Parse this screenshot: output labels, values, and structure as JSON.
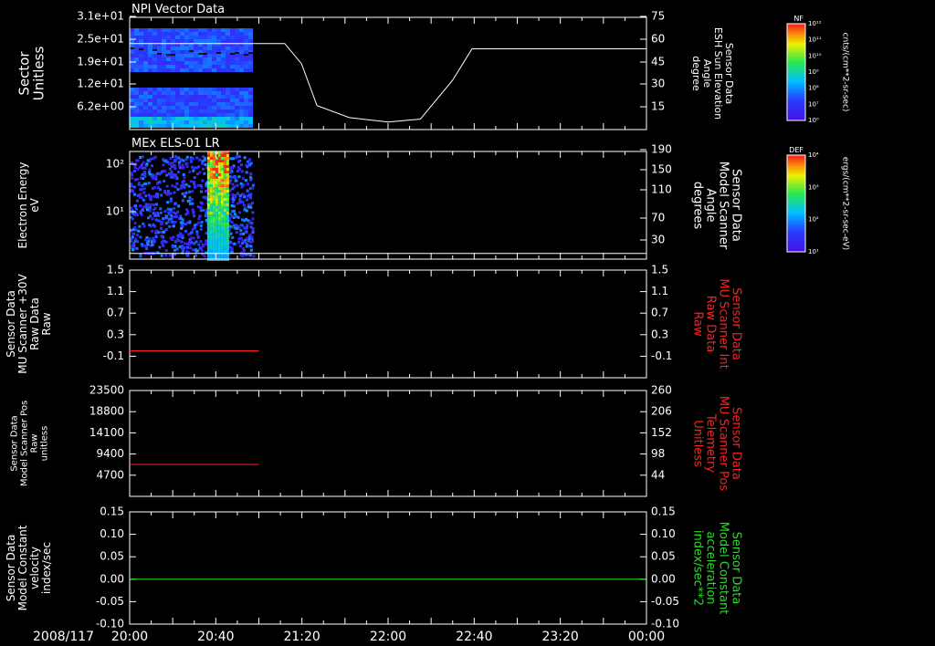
{
  "chart_data": [
    {
      "type": "heatmap",
      "title": "NPI Vector Data",
      "ylabel": [
        "Sector",
        "Unitless"
      ],
      "yticks": [
        "3.1e+01",
        "2.5e+01",
        "1.9e+01",
        "1.2e+01",
        "6.2e+00"
      ],
      "right_ylabel": [
        "Sensor Data",
        "ESH Sun Elevation",
        "Angle",
        "degree"
      ],
      "right_yticks": [
        "75",
        "60",
        "45",
        "30",
        "15"
      ],
      "right_ylim": [
        0,
        75
      ],
      "line_series": {
        "name": "ESH Sun Elevation",
        "color": "#ffffff",
        "x_hours": [
          20.0,
          21.2,
          21.33,
          21.45,
          21.7,
          22.0,
          22.25,
          22.5,
          22.65,
          24.0
        ],
        "y": [
          57.5,
          57.5,
          44,
          16,
          8,
          5,
          7,
          33,
          54,
          54
        ]
      },
      "data_extent_hours": [
        20.0,
        20.95
      ],
      "colorbar": {
        "label": "NF",
        "units": "cnts/(cm**2-sr-sec)",
        "ticks": [
          "10⁰",
          "10⁷",
          "10⁸",
          "10⁹",
          "10¹⁰",
          "10¹¹",
          "10¹²"
        ]
      }
    },
    {
      "type": "heatmap",
      "title": "MEx ELS-01 LR",
      "ylabel": [
        "Electron Energy",
        "eV"
      ],
      "yticks": [
        "10²",
        "10¹"
      ],
      "right_ylabel": [
        "Sensor Data",
        "Model Scanner",
        "Angle",
        "degrees"
      ],
      "right_yticks": [
        "190",
        "150",
        "110",
        "70",
        "30"
      ],
      "right_ylim": [
        0,
        190
      ],
      "line_series": {
        "name": "Model Scanner Angle",
        "color": "#ffffff",
        "x_hours": [
          20.0,
          24.0
        ],
        "y": [
          10,
          10
        ]
      },
      "data_extent_hours": [
        20.0,
        20.95
      ],
      "colorbar": {
        "label": "DEF",
        "units": "ergs/(cm**2-sr-sec-eV)",
        "ticks": [
          "10¹",
          "10²",
          "10³",
          "10⁴"
        ]
      }
    },
    {
      "type": "line",
      "ylabel": [
        "Sensor Data",
        "MU Scanner +30V",
        "Raw Data",
        "Raw"
      ],
      "yticks": [
        "1.5",
        "1.1",
        "0.7",
        "0.3",
        "-0.1"
      ],
      "ylim": [
        -0.5,
        1.5
      ],
      "right_ylabel": [
        "Sensor Data",
        "MU Scanner Int",
        "Raw Data",
        "Raw"
      ],
      "right_yticks": [
        "1.5",
        "1.1",
        "0.7",
        "0.3",
        "-0.1"
      ],
      "series": [
        {
          "color": "#ff2020",
          "x_hours": [
            20.0,
            21.0
          ],
          "y": [
            0.0,
            0.0
          ]
        }
      ]
    },
    {
      "type": "line",
      "ylabel": [
        "Sensor Data",
        "Model Scanner Pos",
        "Raw",
        "unitless"
      ],
      "yticks": [
        "23500",
        "18800",
        "14100",
        "9400",
        "4700"
      ],
      "ylim": [
        0,
        23500
      ],
      "right_ylabel": [
        "Sensor Data",
        "MU Scanner Pos",
        "Telemetry",
        "Unitless"
      ],
      "right_yticks": [
        "260",
        "206",
        "152",
        "98",
        "44"
      ],
      "series": [
        {
          "color": "#ff2020",
          "x_hours": [
            20.0,
            21.0
          ],
          "y": [
            7100,
            7100
          ]
        }
      ]
    },
    {
      "type": "line",
      "ylabel": [
        "Sensor Data",
        "Model Constant",
        "velocity",
        "index/sec"
      ],
      "yticks": [
        "0.15",
        "0.10",
        "0.05",
        "0.00",
        "-0.05",
        "-0.10"
      ],
      "ylim": [
        -0.1,
        0.15
      ],
      "right_ylabel": [
        "Sensor Data",
        "Model Constant",
        "acceleration",
        "index/sec**2"
      ],
      "right_yticks": [
        "0.15",
        "0.10",
        "0.05",
        "0.00",
        "-0.05",
        "-0.10"
      ],
      "series": [
        {
          "color": "#20e020",
          "x_hours": [
            20.0,
            24.0
          ],
          "y": [
            0.0,
            0.0
          ]
        }
      ]
    }
  ],
  "x_axis": {
    "date_label": "2008/117",
    "range_hours": [
      20.0,
      24.0
    ],
    "ticks": [
      {
        "label": "20:00",
        "hour": 20.0
      },
      {
        "label": "20:40",
        "hour": 20.6667
      },
      {
        "label": "21:20",
        "hour": 21.3333
      },
      {
        "label": "22:00",
        "hour": 22.0
      },
      {
        "label": "22:40",
        "hour": 22.6667
      },
      {
        "label": "23:20",
        "hour": 23.3333
      },
      {
        "label": "00:00",
        "hour": 24.0
      }
    ]
  },
  "colors": {
    "left_label": "#ffffff",
    "right_label_red": "#ff2020",
    "right_label_green": "#20e020"
  }
}
